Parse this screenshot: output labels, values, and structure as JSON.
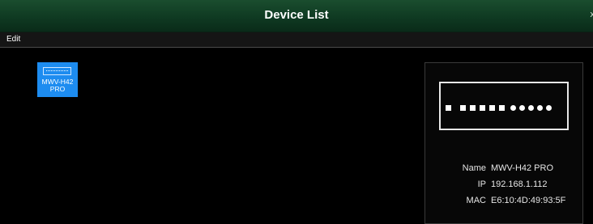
{
  "window": {
    "title": "Device List",
    "close_glyph": "x"
  },
  "menu": {
    "items": [
      "Edit"
    ]
  },
  "devices": [
    {
      "label_line1": "MWV-H42",
      "label_line2": "PRO",
      "selected": true
    }
  ],
  "details": {
    "port_squares": 6,
    "port_circles": 5,
    "fields": [
      {
        "label": "Name",
        "value": "MWV-H42 PRO"
      },
      {
        "label": "IP",
        "value": "192.168.1.112"
      },
      {
        "label": "MAC",
        "value": "E6:10:4D:49:93:5F"
      }
    ]
  },
  "colors": {
    "title_bar": "#0f3a22",
    "selection": "#1d8cf0",
    "background": "#000000"
  }
}
